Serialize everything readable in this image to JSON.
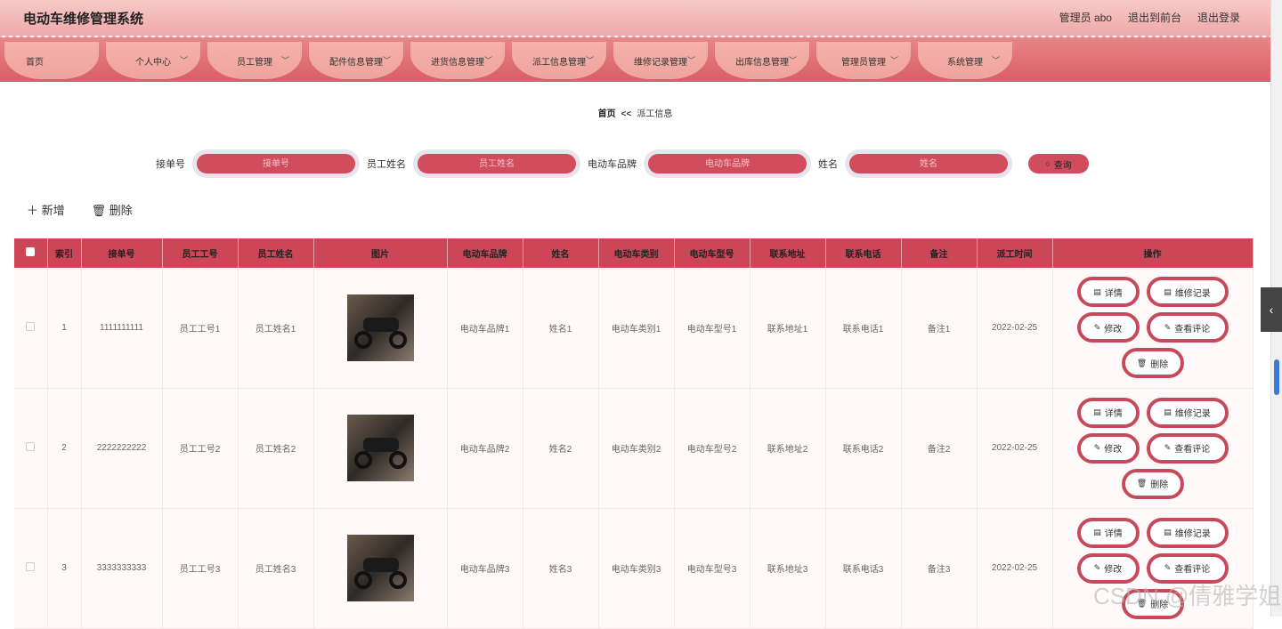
{
  "header": {
    "title": "电动车维修管理系统",
    "links": [
      "管理员 abo",
      "退出到前台",
      "退出登录"
    ]
  },
  "nav": [
    "首页",
    "个人中心",
    "员工管理",
    "配件信息管理",
    "进货信息管理",
    "派工信息管理",
    "维修记录管理",
    "出库信息管理",
    "管理员管理",
    "系统管理"
  ],
  "breadcrumb": {
    "home": "首页",
    "sep": "<<",
    "current": "派工信息"
  },
  "search": {
    "fields": [
      {
        "label": "接单号",
        "placeholder": "接单号"
      },
      {
        "label": "员工姓名",
        "placeholder": "员工姓名"
      },
      {
        "label": "电动车品牌",
        "placeholder": "电动车品牌"
      },
      {
        "label": "姓名",
        "placeholder": "姓名"
      }
    ],
    "button": "查询"
  },
  "actions": {
    "add": "新增",
    "delete": "删除"
  },
  "table": {
    "columns": [
      "索引",
      "接单号",
      "员工工号",
      "员工姓名",
      "图片",
      "电动车品牌",
      "姓名",
      "电动车类别",
      "电动车型号",
      "联系地址",
      "联系电话",
      "备注",
      "派工时间",
      "操作"
    ],
    "rows": [
      {
        "index": "1",
        "order": "1111111111",
        "emp_no": "员工工号1",
        "emp_name": "员工姓名1",
        "brand": "电动车品牌1",
        "name": "姓名1",
        "category": "电动车类别1",
        "model": "电动车型号1",
        "address": "联系地址1",
        "phone": "联系电话1",
        "note": "备注1",
        "time": "2022-02-25"
      },
      {
        "index": "2",
        "order": "2222222222",
        "emp_no": "员工工号2",
        "emp_name": "员工姓名2",
        "brand": "电动车品牌2",
        "name": "姓名2",
        "category": "电动车类别2",
        "model": "电动车型号2",
        "address": "联系地址2",
        "phone": "联系电话2",
        "note": "备注2",
        "time": "2022-02-25"
      },
      {
        "index": "3",
        "order": "3333333333",
        "emp_no": "员工工号3",
        "emp_name": "员工姓名3",
        "brand": "电动车品牌3",
        "name": "姓名3",
        "category": "电动车类别3",
        "model": "电动车型号3",
        "address": "联系地址3",
        "phone": "联系电话3",
        "note": "备注3",
        "time": "2022-02-25"
      }
    ],
    "ops": {
      "detail": "详情",
      "repair": "维修记录",
      "edit": "修改",
      "review": "查看评论",
      "delete": "删除"
    }
  },
  "watermark": "CSDN @倩雅学姐"
}
